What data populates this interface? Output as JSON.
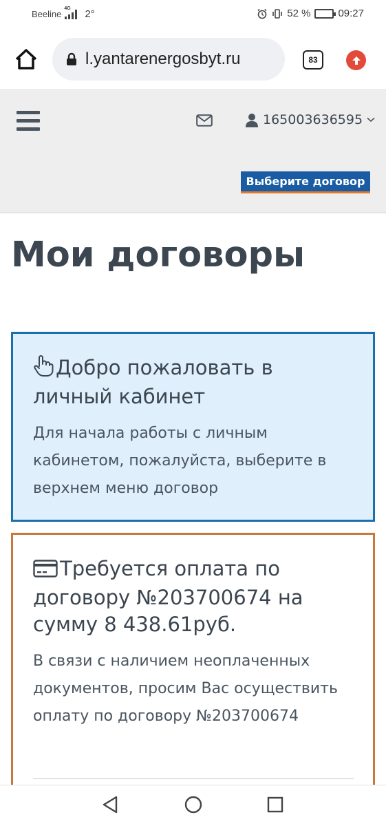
{
  "status_bar": {
    "carrier": "Beeline",
    "network_tag": "4G",
    "temperature": "2°",
    "battery_percent": "52 %",
    "battery_level": 0.52,
    "time": "09:27"
  },
  "browser": {
    "url": "l.yantarenergosbyt.ru",
    "tabs_count": "83"
  },
  "header": {
    "account_number": "165003636595",
    "contract_button": "Выберите договор"
  },
  "main": {
    "title": "Мои договоры",
    "welcome_panel": {
      "title": "Добро пожаловать в личный кабинет",
      "text": "Для начала работы с личным кабинетом, пожалуйста, выберите в верхнем меню договор"
    },
    "payment_panel": {
      "title": "Требуется оплата по договору №203700674 на сумму 8 438.61руб.",
      "text": "В связи с наличием неоплаченных документов, просим Вас осуществить оплату по договору №203700674"
    }
  },
  "colors": {
    "accent_blue": "#1a5ca4",
    "info_border": "#1a6fae",
    "info_background": "#dff0fc",
    "warning_border": "#c8783a",
    "button_underline": "#e07a2c"
  },
  "icons": {
    "home": "home-icon",
    "lock": "lock-icon",
    "tabs": "tabs-counter-icon",
    "upload": "upload-arrow-icon",
    "menu": "hamburger-menu-icon",
    "mail": "mail-icon",
    "user": "user-icon",
    "chevron": "chevron-down-icon",
    "pointer": "hand-pointer-icon",
    "card": "credit-card-icon"
  }
}
